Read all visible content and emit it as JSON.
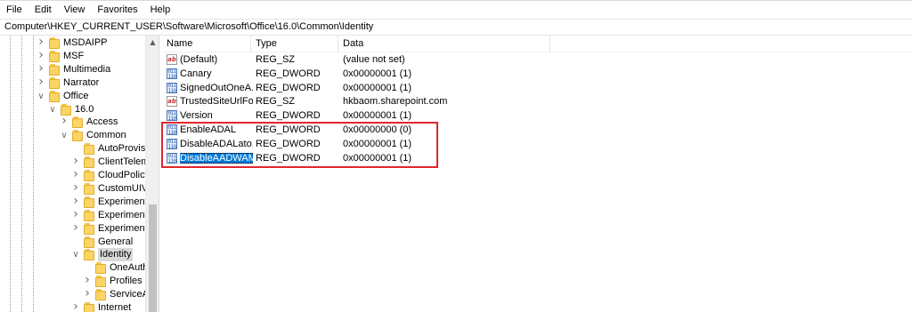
{
  "menu": [
    "File",
    "Edit",
    "View",
    "Favorites",
    "Help"
  ],
  "address": "Computer\\HKEY_CURRENT_USER\\Software\\Microsoft\\Office\\16.0\\Common\\Identity",
  "tree": [
    {
      "label": "MSDAIPP",
      "depth": 0,
      "expander": "right",
      "selected": false
    },
    {
      "label": "MSF",
      "depth": 0,
      "expander": "right",
      "selected": false
    },
    {
      "label": "Multimedia",
      "depth": 0,
      "expander": "right",
      "selected": false
    },
    {
      "label": "Narrator",
      "depth": 0,
      "expander": "right",
      "selected": false
    },
    {
      "label": "Office",
      "depth": 0,
      "expander": "down",
      "selected": false
    },
    {
      "label": "16.0",
      "depth": 1,
      "expander": "down",
      "selected": false
    },
    {
      "label": "Access",
      "depth": 2,
      "expander": "right",
      "selected": false
    },
    {
      "label": "Common",
      "depth": 2,
      "expander": "down",
      "selected": false
    },
    {
      "label": "AutoProvisi",
      "depth": 3,
      "expander": "none",
      "selected": false
    },
    {
      "label": "ClientTelem",
      "depth": 3,
      "expander": "right",
      "selected": false
    },
    {
      "label": "CloudPolicy",
      "depth": 3,
      "expander": "right",
      "selected": false
    },
    {
      "label": "CustomUIV",
      "depth": 3,
      "expander": "right",
      "selected": false
    },
    {
      "label": "Experiment",
      "depth": 3,
      "expander": "right",
      "selected": false
    },
    {
      "label": "Experiment",
      "depth": 3,
      "expander": "right",
      "selected": false
    },
    {
      "label": "Experiment",
      "depth": 3,
      "expander": "right",
      "selected": false
    },
    {
      "label": "General",
      "depth": 3,
      "expander": "none",
      "selected": false
    },
    {
      "label": "Identity",
      "depth": 3,
      "expander": "down",
      "selected": true
    },
    {
      "label": "OneAuth",
      "depth": 4,
      "expander": "none",
      "selected": false
    },
    {
      "label": "Profiles",
      "depth": 4,
      "expander": "right",
      "selected": false
    },
    {
      "label": "ServiceA",
      "depth": 4,
      "expander": "right",
      "selected": false
    },
    {
      "label": "Internet",
      "depth": 3,
      "expander": "right",
      "selected": false
    }
  ],
  "columns": {
    "name": "Name",
    "type": "Type",
    "data": "Data"
  },
  "values": [
    {
      "name": "(Default)",
      "type": "REG_SZ",
      "data": "(value not set)",
      "icon": "string-value-icon",
      "selected": false
    },
    {
      "name": "Canary",
      "type": "REG_DWORD",
      "data": "0x00000001 (1)",
      "icon": "dword-value-icon",
      "selected": false
    },
    {
      "name": "SignedOutOneA...",
      "type": "REG_DWORD",
      "data": "0x00000001 (1)",
      "icon": "dword-value-icon",
      "selected": false
    },
    {
      "name": "TrustedSiteUrlFo...",
      "type": "REG_SZ",
      "data": "hkbaom.sharepoint.com",
      "icon": "string-value-icon",
      "selected": false
    },
    {
      "name": "Version",
      "type": "REG_DWORD",
      "data": "0x00000001 (1)",
      "icon": "dword-value-icon",
      "selected": false
    },
    {
      "name": "EnableADAL",
      "type": "REG_DWORD",
      "data": "0x00000000 (0)",
      "icon": "dword-value-icon",
      "selected": false
    },
    {
      "name": "DisableADALato...",
      "type": "REG_DWORD",
      "data": "0x00000001 (1)",
      "icon": "dword-value-icon",
      "selected": false
    },
    {
      "name": "DisableAADWAM",
      "type": "REG_DWORD",
      "data": "0x00000001 (1)",
      "icon": "dword-value-icon",
      "selected": true
    }
  ],
  "icons": {
    "string_glyph": "ab",
    "binary_glyph": "011 110"
  },
  "colors": {
    "selection": "#0078d7",
    "highlight_box": "#e0262d",
    "folder": "#fbd466"
  }
}
